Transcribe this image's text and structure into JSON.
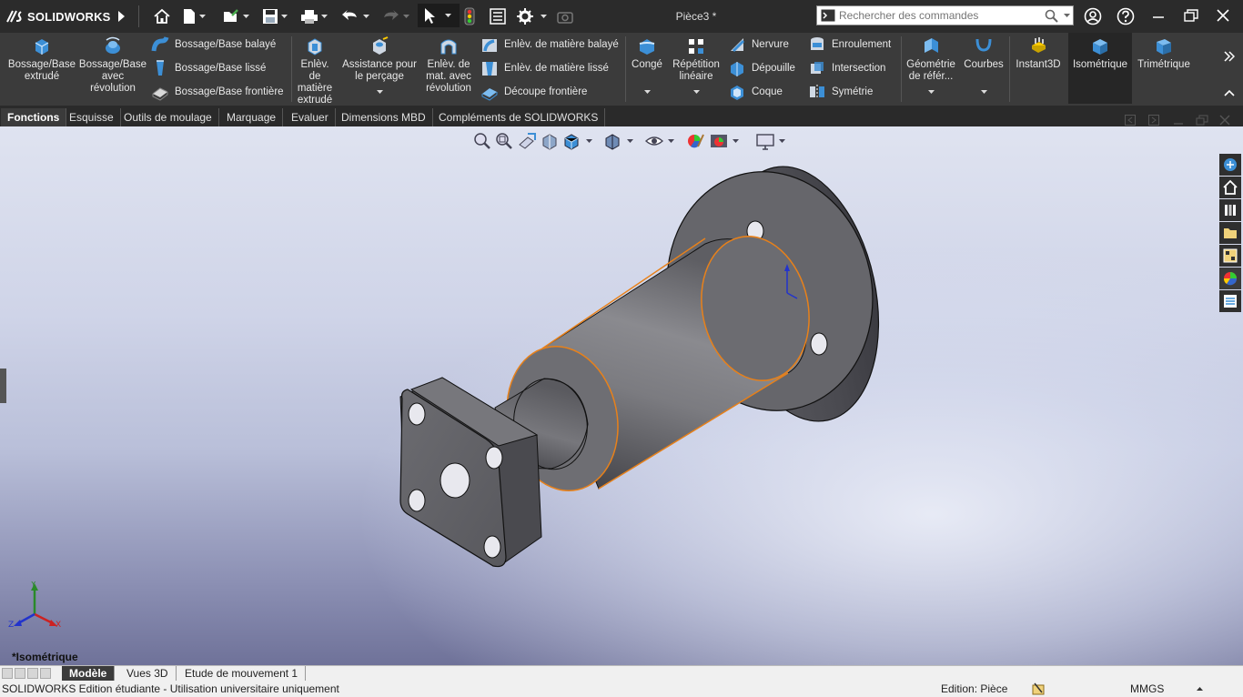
{
  "app": {
    "logo_text": "SOLIDWORKS",
    "document_title": "Pièce3 *"
  },
  "search": {
    "placeholder": "Rechercher des commandes"
  },
  "quick_access": {
    "icons": [
      "home-icon",
      "new-document-icon",
      "open-icon",
      "save-icon",
      "print-icon",
      "undo-icon",
      "redo-icon",
      "select-icon",
      "rebuild-icon",
      "file-properties-icon",
      "options-icon",
      "screen-capture-icon"
    ]
  },
  "command_manager": {
    "buttons": {
      "extruded_boss": "Bossage/Base extrudé",
      "revolved_boss": "Bossage/Base avec révolution",
      "swept_boss": "Bossage/Base balayé",
      "lofted_boss": "Bossage/Base lissé",
      "boundary_boss": "Bossage/Base frontière",
      "extruded_cut": "Enlèv. de matière extrudé",
      "hole_wizard": "Assistance pour le perçage",
      "revolved_cut": "Enlèv. de mat. avec révolution",
      "swept_cut": "Enlèv. de matière balayé",
      "lofted_cut": "Enlèv. de matière lissé",
      "boundary_cut": "Découpe frontière",
      "fillet": "Congé",
      "linear_pattern": "Répétition linéaire",
      "rib": "Nervure",
      "draft": "Dépouille",
      "shell": "Coque",
      "wrap": "Enroulement",
      "intersect": "Intersection",
      "mirror": "Symétrie",
      "reference_geometry": "Géométrie de référ...",
      "curves": "Courbes",
      "instant3d": "Instant3D",
      "isometric": "Isométrique",
      "trimetric": "Trimétrique"
    }
  },
  "tabs": [
    "Fonctions",
    "Esquisse",
    "Outils de moulage",
    "Marquage",
    "Evaluer",
    "Dimensions MBD",
    "Compléments de SOLIDWORKS"
  ],
  "active_tab": "Fonctions",
  "viewport": {
    "view_label": "*Isométrique",
    "triad_axes": [
      "Y",
      "X",
      "Z"
    ]
  },
  "bottom_tabs": [
    "Modèle",
    "Vues 3D",
    "Etude de mouvement 1"
  ],
  "status_bar": {
    "left": "SOLIDWORKS Edition étudiante - Utilisation universitaire uniquement",
    "mode": "Edition: Pièce",
    "units": "MMGS"
  },
  "colors": {
    "ui_dark": "#2b2b2b",
    "ribbon": "#3b3b3b",
    "accent_blue": "#3c8fd6",
    "selection_edge": "#e8811a",
    "part_gray": "#5e5e62"
  }
}
